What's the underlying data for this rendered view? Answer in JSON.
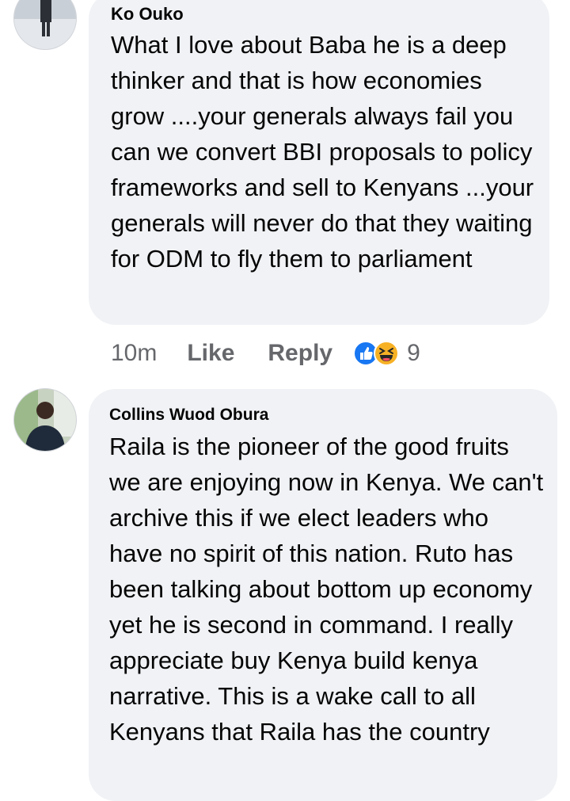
{
  "comments": [
    {
      "author": "Ko Ouko",
      "text": "What I love about Baba he is a deep thinker and that is how economies grow ....your generals always fail you can we convert BBI proposals to policy frameworks and sell to Kenyans ...your generals will never do that they waiting for ODM to fly them to parliament",
      "time": "10m",
      "like_label": "Like",
      "reply_label": "Reply",
      "reaction_count": "9",
      "reactions": [
        "like-icon",
        "haha-icon"
      ]
    },
    {
      "author": "Collins Wuod Obura",
      "text": "Raila is the pioneer of the good fruits we are enjoying now in Kenya. We can't archive this if we elect leaders who have no spirit of this nation. Ruto has been talking about bottom up economy yet he is second in command. I really appreciate buy Kenya build kenya narrative. This is a wake call to all Kenyans that Raila has the country"
    }
  ],
  "colors": {
    "bubble": "#f0f2f5",
    "text": "#050505",
    "meta": "#65676b",
    "like_blue": "#1877f2",
    "haha_yellow": "#f7b125"
  }
}
